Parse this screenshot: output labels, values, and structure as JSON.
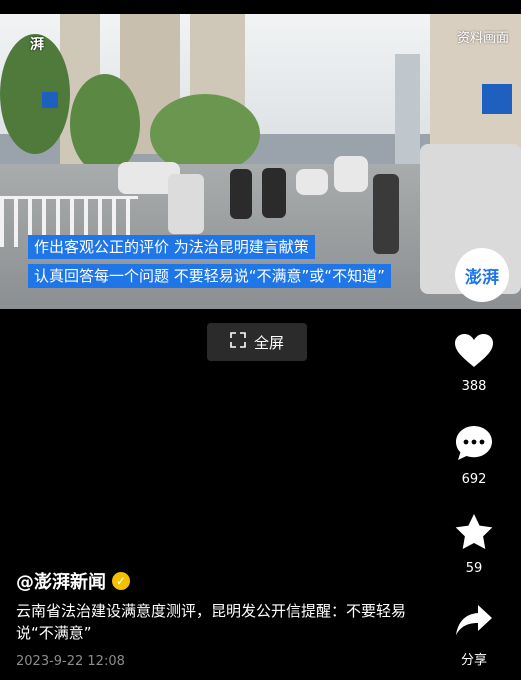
{
  "video": {
    "top_badge": "资料画面",
    "logo_text": "湃",
    "caption_1": "作出客观公正的评价  为法治昆明建言献策",
    "caption_2": "认真回答每一个问题  不要轻易说“不满意”或“不知道”",
    "watermark": "澎湃"
  },
  "fullscreen_button": {
    "label": "全屏",
    "icon": "expand-icon"
  },
  "actions": {
    "like": {
      "icon": "heart-icon",
      "count": "388"
    },
    "comment": {
      "icon": "comment-icon",
      "count": "692"
    },
    "favorite": {
      "icon": "star-icon",
      "count": "59"
    },
    "share": {
      "icon": "share-icon",
      "label": "分享"
    }
  },
  "post": {
    "author": "@澎湃新闻",
    "verified_icon": "verified-badge-icon",
    "description": "云南省法治建设满意度测评，昆明发公开信提醒：不要轻易说“不满意”",
    "timestamp": "2023-9-22 12:08"
  },
  "colors": {
    "caption_bg": "#1f76e8",
    "verified": "#f2c100",
    "background": "#000000"
  }
}
